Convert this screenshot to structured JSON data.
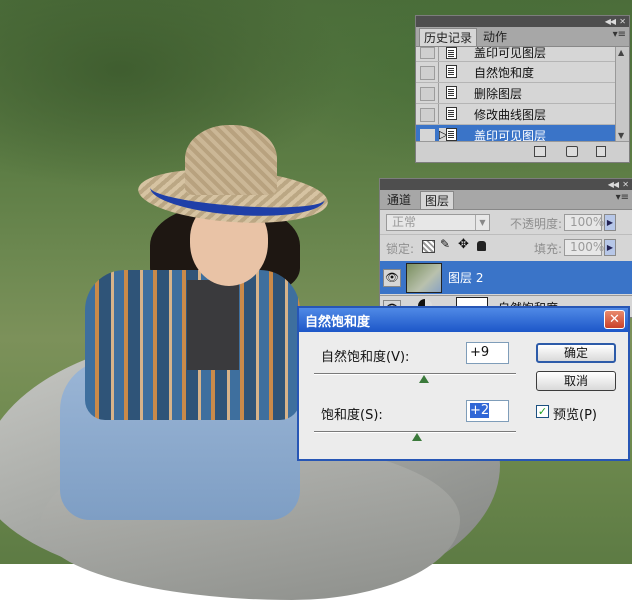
{
  "history_panel": {
    "tabs": [
      "历史记录",
      "动作"
    ],
    "items": [
      "盖印可见图层",
      "自然饱和度",
      "删除图层",
      "修改曲线图层",
      "盖印可见图层"
    ],
    "selected_index": 4
  },
  "layers_panel": {
    "tabs": [
      "通道",
      "图层"
    ],
    "blend_mode": "正常",
    "opacity_label": "不透明度:",
    "opacity_value": "100%",
    "lock_label": "锁定:",
    "fill_label": "填充:",
    "fill_value": "100%",
    "layer_name": "图层 2",
    "partial_layer_name": "自然饱和度"
  },
  "dialog": {
    "title": "自然饱和度",
    "close_glyph": "✕",
    "vibrance_label": "自然饱和度(V):",
    "vibrance_value": "+9",
    "vibrance_level": 9,
    "saturation_label": "饱和度(S):",
    "saturation_value": "+2",
    "saturation_level": 2,
    "ok_label": "确定",
    "cancel_label": "取消",
    "preview_label": "预览(P)",
    "preview_checked": true
  },
  "colors": {
    "selection_blue": "#3a74c8",
    "title_bar_blue": "#1d57c8",
    "panel_gray": "#d6d6d6"
  }
}
